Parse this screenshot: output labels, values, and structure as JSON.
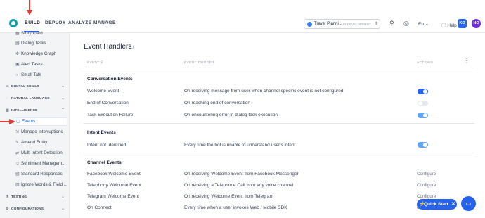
{
  "topbar": {
    "tabs": [
      {
        "label": "BUILD",
        "active": true
      },
      {
        "label": "DEPLOY",
        "active": false
      },
      {
        "label": "ANALYZE",
        "active": false
      },
      {
        "label": "MANAGE",
        "active": false
      }
    ],
    "bot_name": "Travel Planni...",
    "bot_status": "IN DEVELOPMENT",
    "language": "En",
    "help_label": "Help",
    "avatars": [
      "KO",
      "NO"
    ],
    "icons": [
      "search-icon",
      "settings-icon",
      "globe-icon",
      "help-icon"
    ],
    "accent_color": "#2563eb"
  },
  "sidebar": {
    "items_top": [
      {
        "label": "Storyboard",
        "icon": "storyboard-icon"
      },
      {
        "label": "Dialog Tasks",
        "icon": "dialog-icon"
      },
      {
        "label": "Knowledge Graph",
        "icon": "graph-icon"
      },
      {
        "label": "Alert Tasks",
        "icon": "alert-icon"
      },
      {
        "label": "Small Talk",
        "icon": "chat-icon"
      }
    ],
    "sections": [
      {
        "label": "DIGITAL SKILLS"
      },
      {
        "label": "NATURAL LANGUAGE"
      },
      {
        "label": "INTELLIGENCE"
      },
      {
        "label": "TESTING"
      },
      {
        "label": "CONFIGURATIONS"
      }
    ],
    "intelligence_items": [
      {
        "label": "Events",
        "selected": true
      },
      {
        "label": "Manage Interruptions"
      },
      {
        "label": "Amend Entity"
      },
      {
        "label": "Multi intent Detection"
      },
      {
        "label": "Sentiment Managem..."
      },
      {
        "label": "Standard Responses"
      },
      {
        "label": "Ignore Words & Field ..."
      }
    ]
  },
  "main": {
    "title": "Event Handlers",
    "columns": {
      "event": "EVENT",
      "trigger": "EVENT TRIGGER",
      "actions": "ACTIONS"
    },
    "groups": [
      {
        "label": "Conversation Events",
        "rows": [
          {
            "name": "Welcome Event",
            "trigger": "On receiving message from user when channel specific event is not configured",
            "toggle": "on"
          },
          {
            "name": "End of Conversation",
            "trigger": "On reaching end of conversation",
            "toggle": "off"
          },
          {
            "name": "Task Execution Failure",
            "trigger": "On encountering error in dialog task execution",
            "toggle": "on-dim"
          }
        ]
      },
      {
        "label": "Intent Events",
        "rows": [
          {
            "name": "Intent not Identified",
            "trigger": "Every time the bot is unable to understand user's intent",
            "toggle": "on-dim"
          }
        ]
      },
      {
        "label": "Channel Events",
        "rows": [
          {
            "name": "Facebook Welcome Event",
            "trigger": "On receiving Welcome Event from Facebook Messenger",
            "action": "Configure"
          },
          {
            "name": "Telephony Welcome Event",
            "trigger": "On receiving a Telephone Call from any voice channel",
            "action": "Configure"
          },
          {
            "name": "Telegram Welcome Event",
            "trigger": "On receiving Welcome Event from Telegram",
            "action": "Configure"
          },
          {
            "name": "On Connect",
            "trigger": "Every time when a user invokes Web / Mobile SDK",
            "action": "Configure"
          }
        ]
      }
    ]
  },
  "quick_start": "Quick Start"
}
